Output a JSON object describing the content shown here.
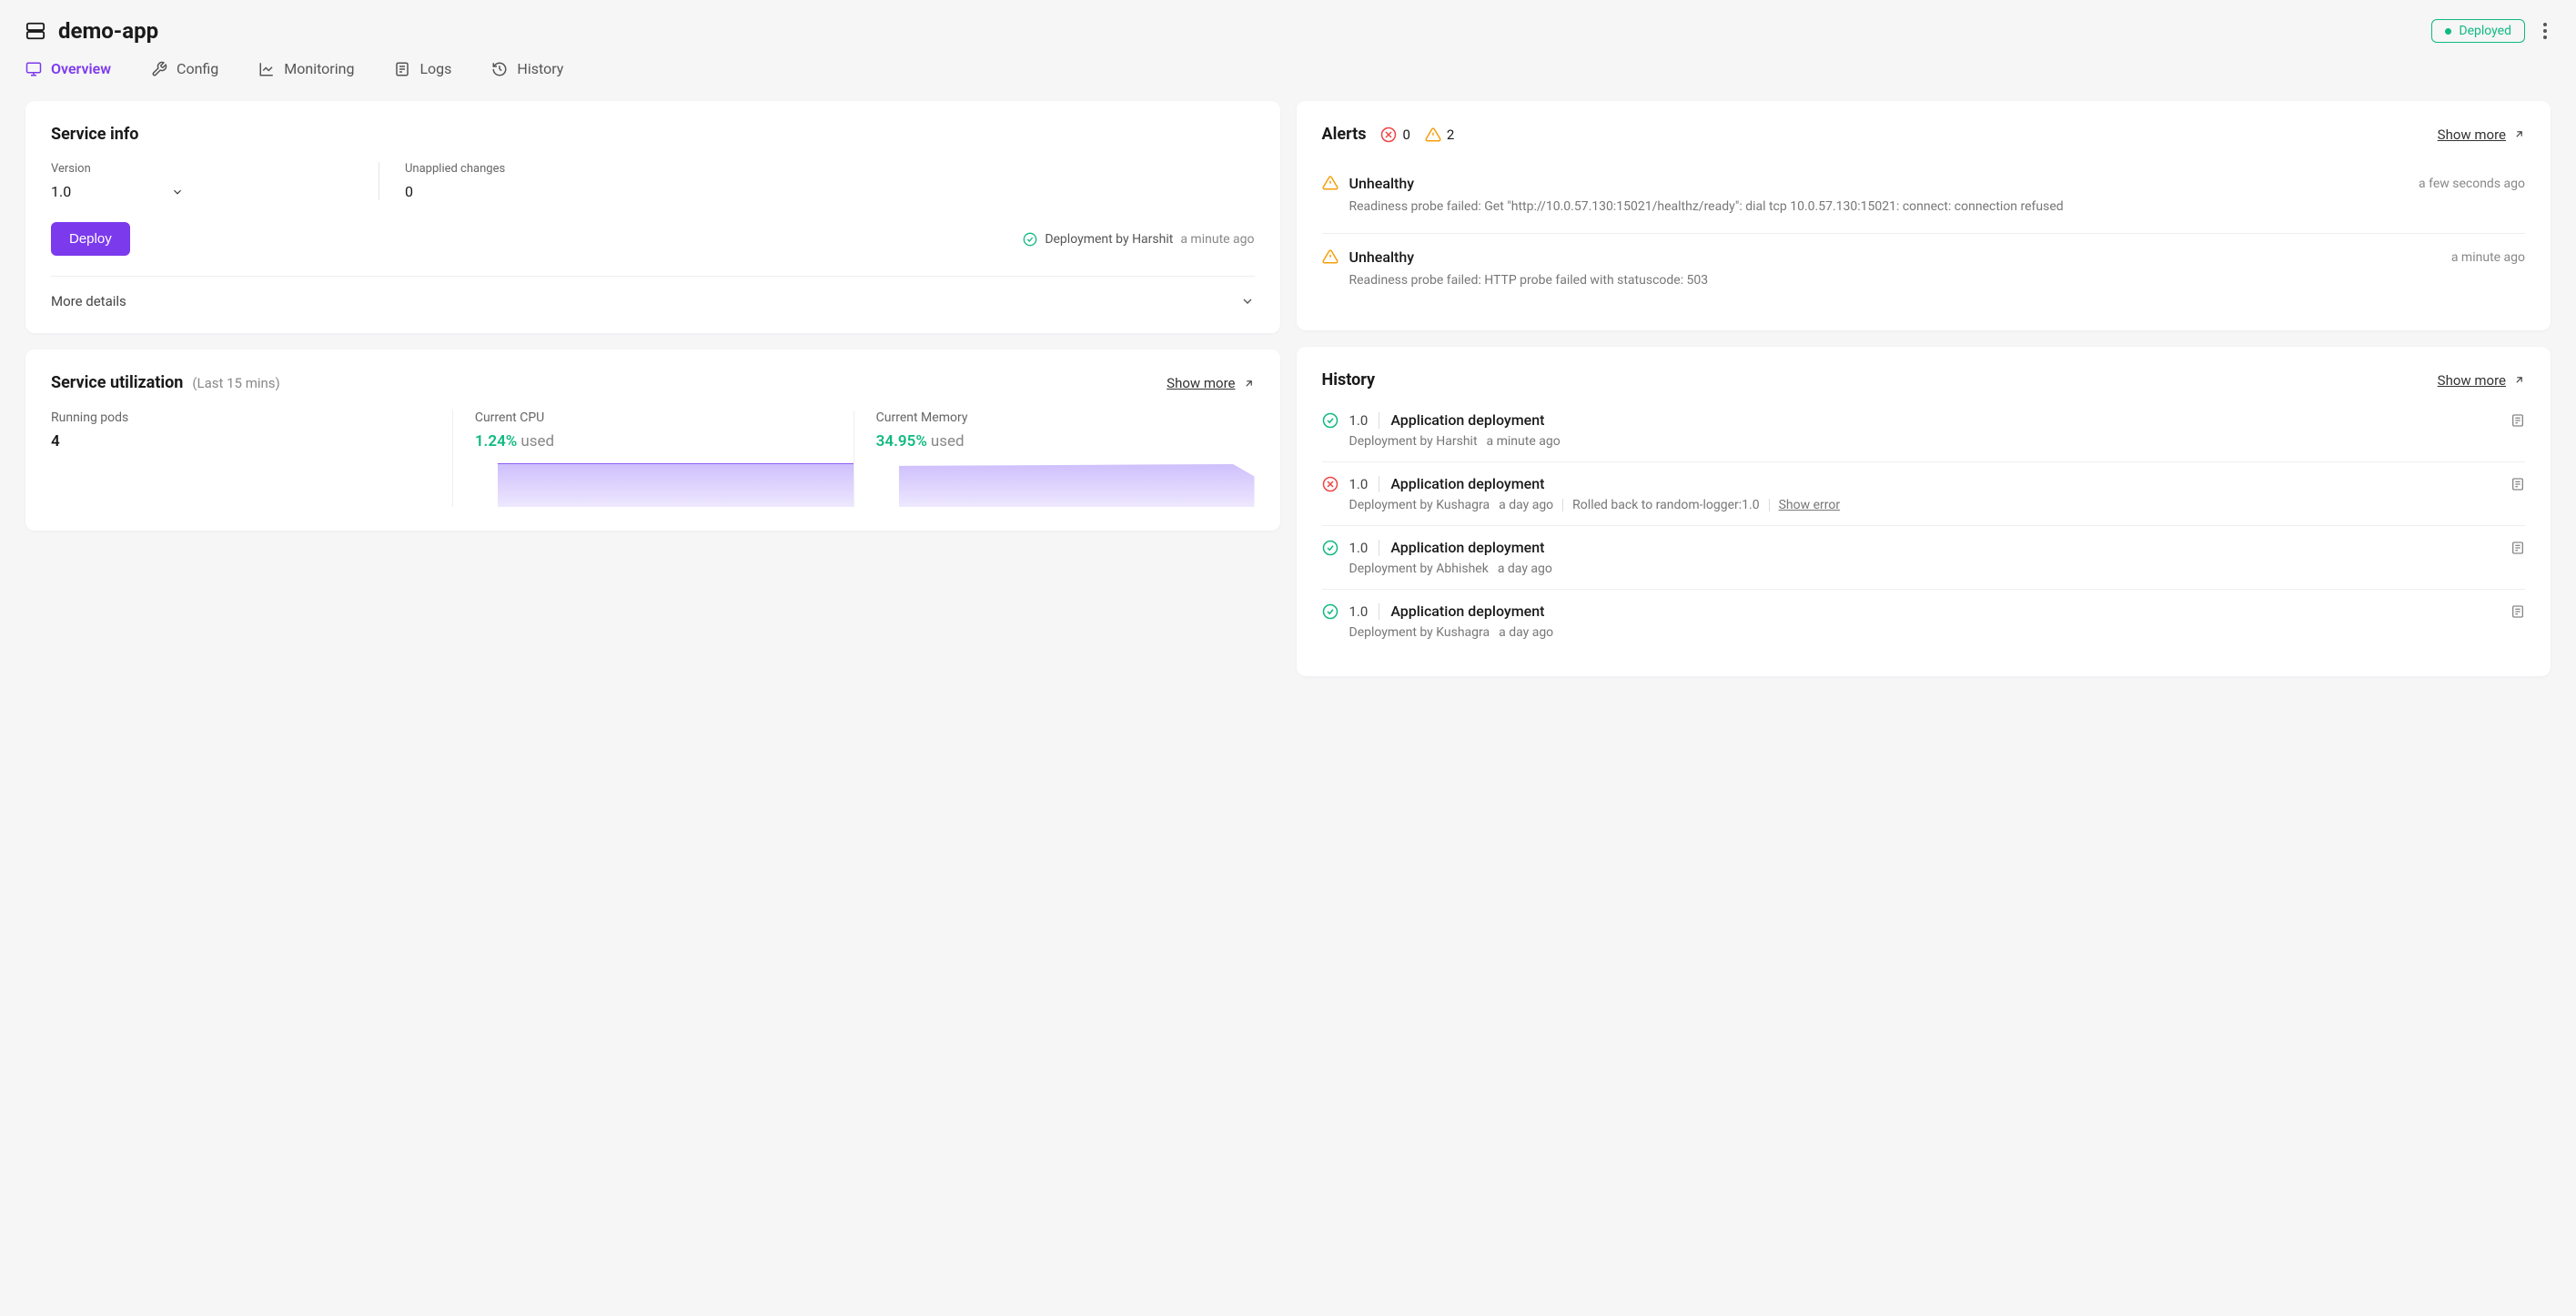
{
  "header": {
    "appName": "demo-app",
    "statusBadge": "Deployed"
  },
  "tabs": [
    {
      "id": "overview",
      "label": "Overview",
      "active": true
    },
    {
      "id": "config",
      "label": "Config",
      "active": false
    },
    {
      "id": "monitoring",
      "label": "Monitoring",
      "active": false
    },
    {
      "id": "logs",
      "label": "Logs",
      "active": false
    },
    {
      "id": "history",
      "label": "History",
      "active": false
    }
  ],
  "serviceInfo": {
    "title": "Service info",
    "versionLabel": "Version",
    "versionValue": "1.0",
    "unappliedLabel": "Unapplied changes",
    "unappliedValue": "0",
    "deployBtn": "Deploy",
    "deployStatus": "Deployment by Harshit",
    "deployTime": "a minute ago",
    "moreDetails": "More details"
  },
  "utilization": {
    "title": "Service utilization",
    "subtitle": "(Last 15 mins)",
    "showMore": "Show more",
    "runningLabel": "Running pods",
    "runningValue": "4",
    "cpuLabel": "Current CPU",
    "cpuPct": "1.24%",
    "cpuUsed": "used",
    "memLabel": "Current Memory",
    "memPct": "34.95%",
    "memUsed": "used"
  },
  "alerts": {
    "title": "Alerts",
    "errorCount": "0",
    "warningCount": "2",
    "showMore": "Show more",
    "items": [
      {
        "title": "Unhealthy",
        "time": "a few seconds ago",
        "message": "Readiness probe failed: Get \"http://10.0.57.130:15021/healthz/ready\": dial tcp 10.0.57.130:15021: connect: connection refused"
      },
      {
        "title": "Unhealthy",
        "time": "a minute ago",
        "message": "Readiness probe failed: HTTP probe failed with statuscode: 503"
      }
    ]
  },
  "history": {
    "title": "History",
    "showMore": "Show more",
    "items": [
      {
        "status": "ok",
        "version": "1.0",
        "label": "Application deployment",
        "by": "Deployment by Harshit",
        "time": "a minute ago",
        "rolledBack": "",
        "showError": ""
      },
      {
        "status": "err",
        "version": "1.0",
        "label": "Application deployment",
        "by": "Deployment by Kushagra",
        "time": "a day ago",
        "rolledBack": "Rolled back to random-logger:1.0",
        "showError": "Show error"
      },
      {
        "status": "ok",
        "version": "1.0",
        "label": "Application deployment",
        "by": "Deployment by Abhishek",
        "time": "a day ago",
        "rolledBack": "",
        "showError": ""
      },
      {
        "status": "ok",
        "version": "1.0",
        "label": "Application deployment",
        "by": "Deployment by Kushagra",
        "time": "a day ago",
        "rolledBack": "",
        "showError": ""
      }
    ]
  }
}
